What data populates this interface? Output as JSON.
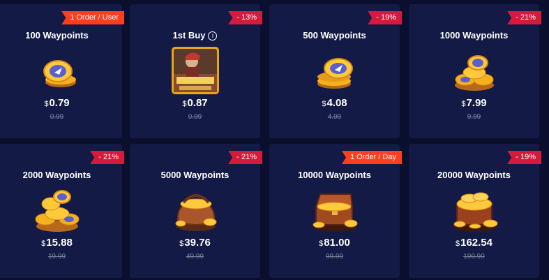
{
  "currency_symbol": "$",
  "cards": [
    {
      "title": "100 Waypoints",
      "badge": "1 Order / User",
      "price": "0.79",
      "old_price": "0.99",
      "art": "coin-stack-icon"
    },
    {
      "title": "1st Buy",
      "badge": "- 13%",
      "price": "0.87",
      "old_price": "0.99",
      "art": "hero-bundle-thumbnail"
    },
    {
      "title": "500 Waypoints",
      "badge": "- 19%",
      "price": "4.08",
      "old_price": "4.99",
      "art": "coin-stack-icon"
    },
    {
      "title": "1000 Waypoints",
      "badge": "- 21%",
      "price": "7.99",
      "old_price": "9.99",
      "art": "coin-pile-icon"
    },
    {
      "title": "2000 Waypoints",
      "badge": "- 21%",
      "price": "15.88",
      "old_price": "19.99",
      "art": "coin-pile-icon"
    },
    {
      "title": "5000 Waypoints",
      "badge": "- 21%",
      "price": "39.76",
      "old_price": "49.99",
      "art": "coin-pouch-icon"
    },
    {
      "title": "10000 Waypoints",
      "badge": "1 Order / Day",
      "price": "81.00",
      "old_price": "99.99",
      "art": "treasure-chest-icon"
    },
    {
      "title": "20000 Waypoints",
      "badge": "- 19%",
      "price": "162.54",
      "old_price": "199.90",
      "art": "treasure-chest-icon"
    }
  ],
  "colors": {
    "background": "#0b0f2e",
    "card": "#131a45",
    "discount_badge": "#d61a3c",
    "limit_badge": "#ff3d1f",
    "coin": "#f5b21e"
  }
}
